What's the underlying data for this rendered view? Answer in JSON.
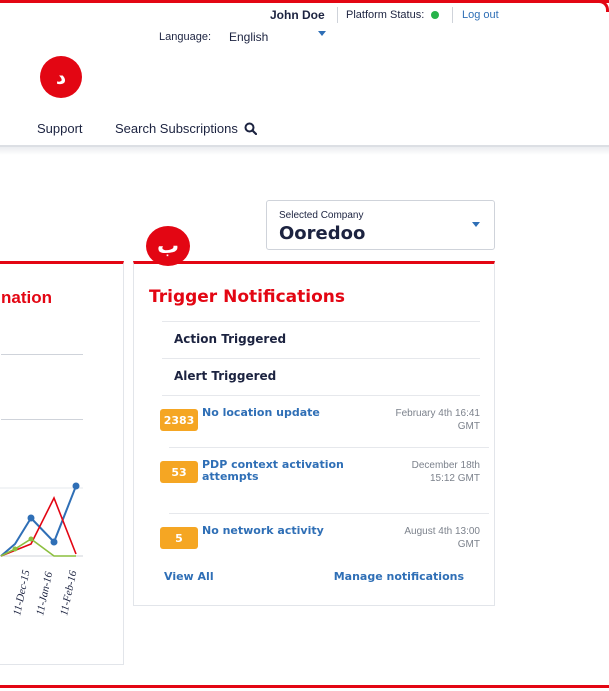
{
  "header": {
    "user_name": "John Doe",
    "platform_status_label": "Platform Status:",
    "platform_status_color": "#27b24a",
    "logout_label": "Log out",
    "language_label": "Language:",
    "language_value": "English"
  },
  "badges": {
    "top_glyph": "د",
    "mid_glyph": "ب"
  },
  "nav": {
    "support_label": "Support",
    "search_label": "Search Subscriptions",
    "search_icon": "search-icon"
  },
  "company": {
    "label": "Selected Company",
    "value": "Ooredoo"
  },
  "left_card": {
    "title_fragment": "nation",
    "chart_data": {
      "type": "line",
      "categories": [
        "11-Dec-15",
        "11-Jan-16",
        "11-Feb-16"
      ],
      "series_colors": [
        "#2f6fb6",
        "#e30613",
        "#8cbf3f"
      ]
    }
  },
  "trigger": {
    "title": "Trigger Notifications",
    "rows": [
      {
        "label": "Action Triggered"
      },
      {
        "label": "Alert Triggered"
      }
    ],
    "notifications": [
      {
        "count": "2383",
        "title": "No location update",
        "date": "February 4th 16:41 GMT"
      },
      {
        "count": "53",
        "title": "PDP context activation attempts",
        "date": "December 18th 15:12 GMT"
      },
      {
        "count": "5",
        "title": "No network activity",
        "date": "August 4th 13:00 GMT"
      }
    ],
    "view_all_label": "View All",
    "manage_label": "Manage notifications"
  },
  "colors": {
    "accent": "#e30613",
    "link": "#2f6fb6",
    "badge": "#f5a623",
    "text": "#1c2340"
  }
}
